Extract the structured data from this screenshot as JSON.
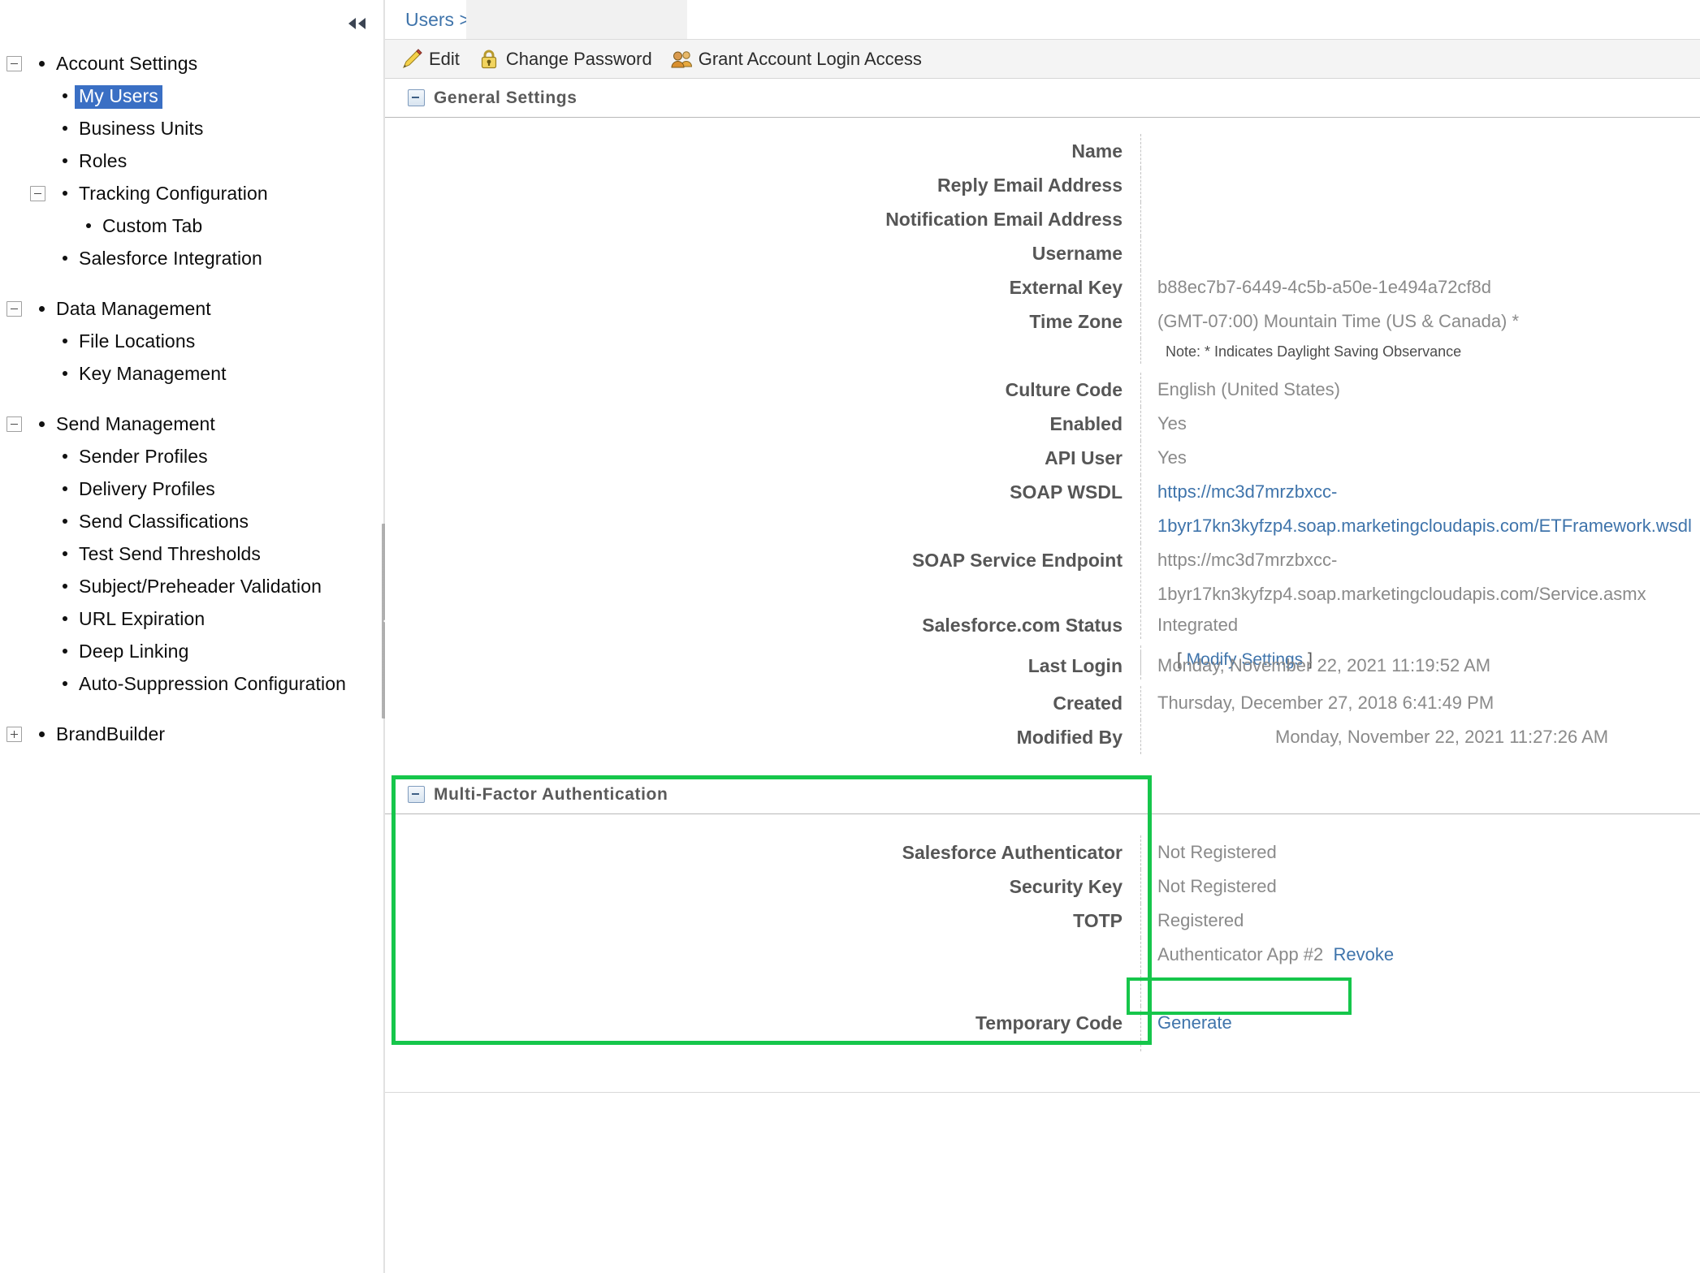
{
  "sidebar": {
    "collapse_icon": "double-chevron-left-icon",
    "groups": [
      {
        "label": "Account Settings",
        "toggle": "minus",
        "children": [
          {
            "label": "My Users",
            "selected": true
          },
          {
            "label": "Business Units",
            "selected": false
          },
          {
            "label": "Roles",
            "selected": false
          },
          {
            "label": "Tracking Configuration",
            "toggle": "minus",
            "children": [
              {
                "label": "Custom Tab"
              }
            ]
          },
          {
            "label": "Salesforce Integration",
            "selected": false
          }
        ]
      },
      {
        "label": "Data Management",
        "toggle": "minus",
        "children": [
          {
            "label": "File Locations"
          },
          {
            "label": "Key Management"
          }
        ]
      },
      {
        "label": "Send Management",
        "toggle": "minus",
        "children": [
          {
            "label": "Sender Profiles"
          },
          {
            "label": "Delivery Profiles"
          },
          {
            "label": "Send Classifications"
          },
          {
            "label": "Test Send Thresholds"
          },
          {
            "label": "Subject/Preheader Validation"
          },
          {
            "label": "URL Expiration"
          },
          {
            "label": "Deep Linking"
          },
          {
            "label": "Auto-Suppression Configuration"
          }
        ]
      },
      {
        "label": "BrandBuilder",
        "toggle": "plus",
        "children": []
      }
    ]
  },
  "breadcrumb": {
    "text": "Users >"
  },
  "toolbar": {
    "items": [
      {
        "label": "Edit",
        "icon": "pencil-icon"
      },
      {
        "label": "Change Password",
        "icon": "padlock-icon"
      },
      {
        "label": "Grant Account Login Access",
        "icon": "two-users-icon"
      }
    ]
  },
  "general_settings": {
    "title": "General Settings",
    "fields": [
      {
        "label": "Name",
        "value": ""
      },
      {
        "label": "Reply Email Address",
        "value": ""
      },
      {
        "label": "Notification Email Address",
        "value": ""
      },
      {
        "label": "Username",
        "value": ""
      },
      {
        "label": "External Key",
        "value": "b88ec7b7-6449-4c5b-a50e-1e494a72cf8d"
      },
      {
        "label": "Time Zone",
        "value": "(GMT-07:00) Mountain Time (US & Canada) *"
      }
    ],
    "timezone_note": "Note: * Indicates Daylight Saving Observance",
    "culture_code_label": "Culture Code",
    "culture_code_value": "English (United States)",
    "enabled_label": "Enabled",
    "enabled_value": "Yes",
    "api_user_label": "API User",
    "api_user_value": "Yes",
    "soap_wsdl_label": "SOAP WSDL",
    "soap_wsdl_value": "https://mc3d7mrzbxcc-1byr17kn3kyfzp4.soap.marketingcloudapis.com/ETFramework.wsdl",
    "soap_endpoint_label": "SOAP Service Endpoint",
    "soap_endpoint_value": "https://mc3d7mrzbxcc-1byr17kn3kyfzp4.soap.marketingcloudapis.com/Service.asmx",
    "sfdc_status_label": "Salesforce.com Status",
    "sfdc_status_value": "Integrated",
    "modify_settings_prefix": "[ ",
    "modify_settings_link": "Modify Settings",
    "modify_settings_suffix": " ]",
    "last_login_label": "Last Login",
    "last_login_value": "Monday, November 22, 2021 11:19:52 AM",
    "created_label": "Created",
    "created_value": "Thursday, December 27, 2018 6:41:49 PM",
    "modified_by_label": "Modified By",
    "modified_by_value": "Monday, November 22, 2021 11:27:26 AM"
  },
  "mfa": {
    "title": "Multi-Factor Authentication",
    "salesforce_authenticator_label": "Salesforce Authenticator",
    "salesforce_authenticator_value": "Not Registered",
    "security_key_label": "Security Key",
    "security_key_value": "Not Registered",
    "totp_label": "TOTP",
    "totp_value": "Registered",
    "device_name": "Authenticator App #2",
    "revoke_label": "Revoke",
    "temporary_code_label": "Temporary Code",
    "generate_label": "Generate"
  },
  "colors": {
    "highlight": "#16c64b",
    "link": "#3f74ab",
    "selection": "#3a6fc4",
    "label": "#565656",
    "value": "#8a8a8a"
  }
}
